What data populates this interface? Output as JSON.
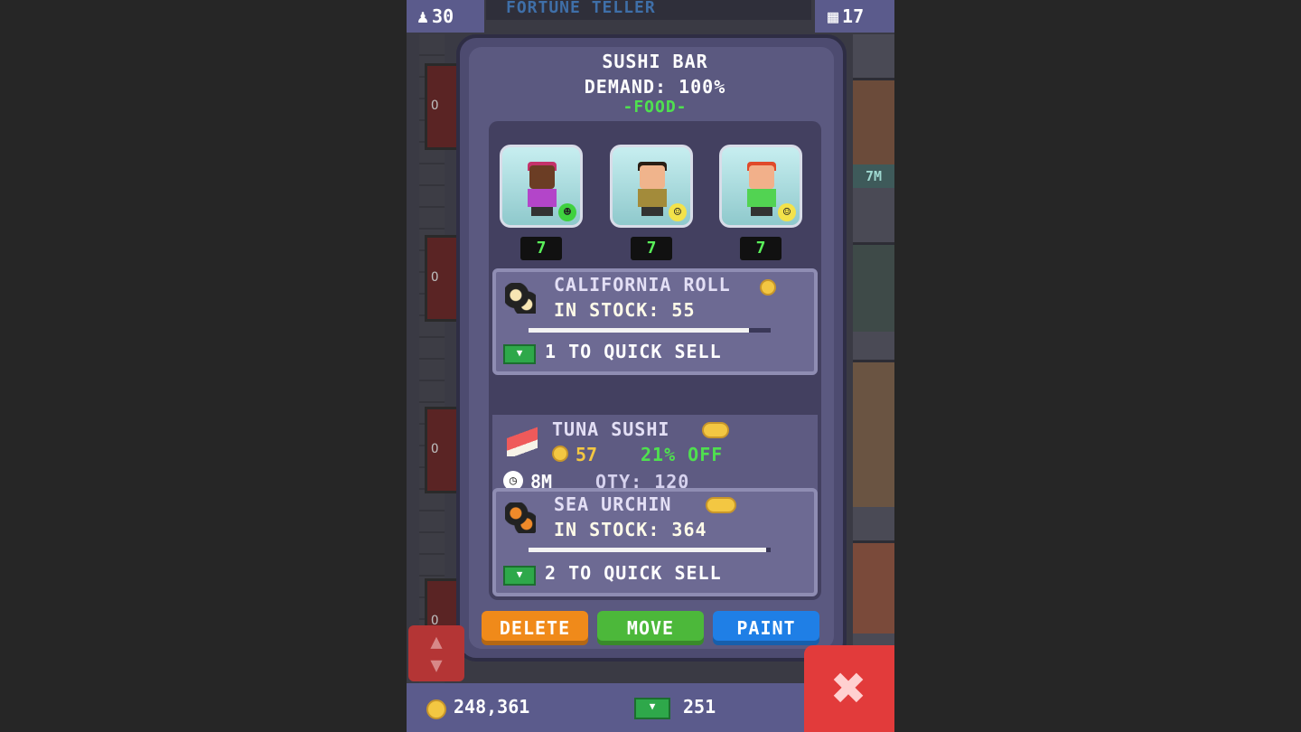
{
  "topbar": {
    "population": "30",
    "floor_name": "FORTUNE TELLER",
    "floors": "17"
  },
  "panel": {
    "title": "SUSHI BAR",
    "demand": "DEMAND: 100%",
    "category": "-FOOD-"
  },
  "workers": [
    {
      "count": "7",
      "face": "happy"
    },
    {
      "count": "7",
      "face": "neutral"
    },
    {
      "count": "7",
      "face": "neutral"
    }
  ],
  "side_labels": {
    "timer": "7M"
  },
  "stock_items": [
    {
      "name": "CALIFORNIA ROLL",
      "line2": "IN STOCK: 55",
      "quick_sell": "1 TO QUICK SELL",
      "stock_fill": 0.91
    },
    {
      "name": "SEA URCHIN",
      "line2": "IN STOCK: 364",
      "quick_sell": "2 TO QUICK SELL",
      "stock_fill": 0.98
    }
  ],
  "restock": {
    "name": "TUNA SUSHI",
    "price": "57",
    "discount": "21% OFF",
    "time": "8M",
    "qty": "QTY: 120"
  },
  "buttons": {
    "delete": "DELETE",
    "move": "MOVE",
    "paint": "PAINT"
  },
  "bottombar": {
    "coins": "248,361",
    "bux": "251"
  },
  "colors": {
    "delete": "#f08a1a",
    "move": "#4cb83a",
    "paint": "#1f7fe6",
    "close": "#e23b3b",
    "accent_green": "#4fe04f"
  }
}
